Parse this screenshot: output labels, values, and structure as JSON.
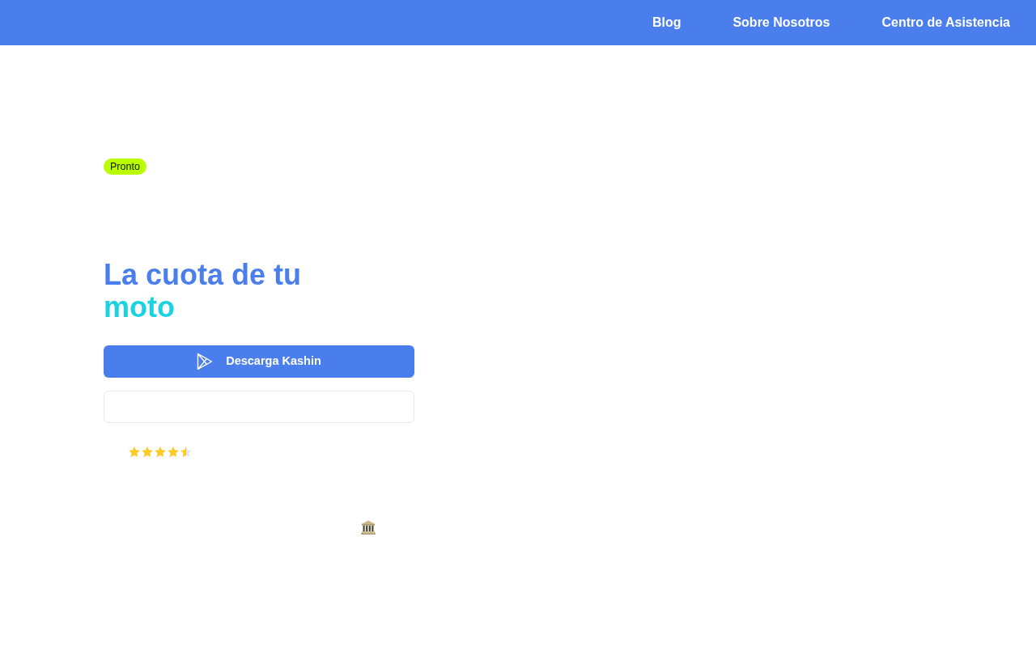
{
  "nav": {
    "links": [
      "Blog",
      "Sobre Nosotros",
      "Centro de Asistencia"
    ]
  },
  "badge": "Pronto",
  "headline": {
    "text": "La cuota de tu",
    "highlight": "moto"
  },
  "download_button": {
    "label": "Descarga Kashin"
  },
  "rating": {
    "stars": 4.5
  }
}
